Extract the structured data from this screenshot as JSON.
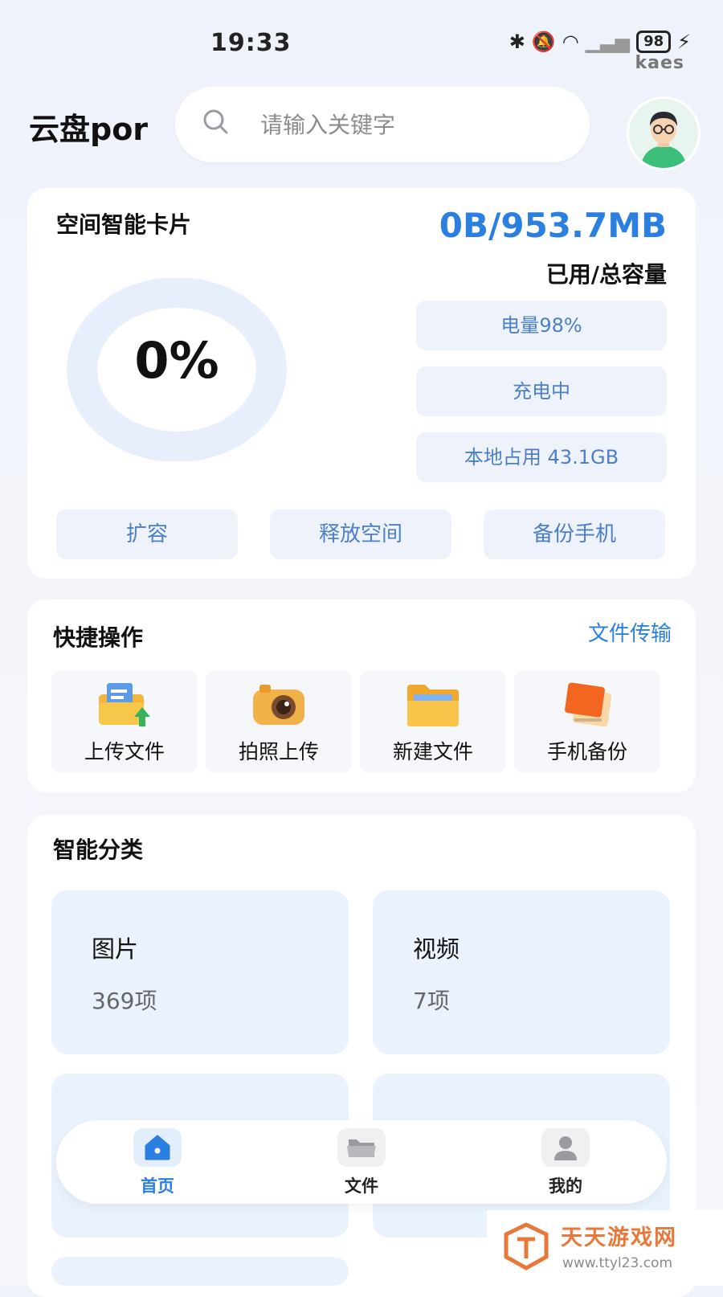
{
  "status_bar": {
    "time": "19:33",
    "battery": "98",
    "carrier_label": "kaes"
  },
  "header": {
    "app_title": "云盘por",
    "search_placeholder": "请输入关键字"
  },
  "storage": {
    "title": "空间智能卡片",
    "used_total": "0B/953.7MB",
    "used_total_label": "已用/总容量",
    "usage_percent": "0%",
    "info": [
      "电量98%",
      "充电中",
      "本地占用 43.1GB"
    ],
    "actions": [
      "扩容",
      "释放空间",
      "备份手机"
    ]
  },
  "quick_actions": {
    "title": "快捷操作",
    "link": "文件传输",
    "items": [
      "上传文件",
      "拍照上传",
      "新建文件",
      "手机备份"
    ]
  },
  "categories": {
    "title": "智能分类",
    "tiles": [
      {
        "name": "图片",
        "count": "369项"
      },
      {
        "name": "视频",
        "count": "7项"
      }
    ]
  },
  "bottom_nav": {
    "items": [
      "首页",
      "文件",
      "我的"
    ],
    "active_color": "#2b7fe0"
  },
  "watermark": {
    "name": "天天游戏网",
    "url": "www.ttyl23.com"
  },
  "colors": {
    "accent": "#2b7fe0",
    "pill_bg": "#eef3fb",
    "pill_text": "#4d7fc8",
    "tile_bg": "#eaf3fd"
  }
}
